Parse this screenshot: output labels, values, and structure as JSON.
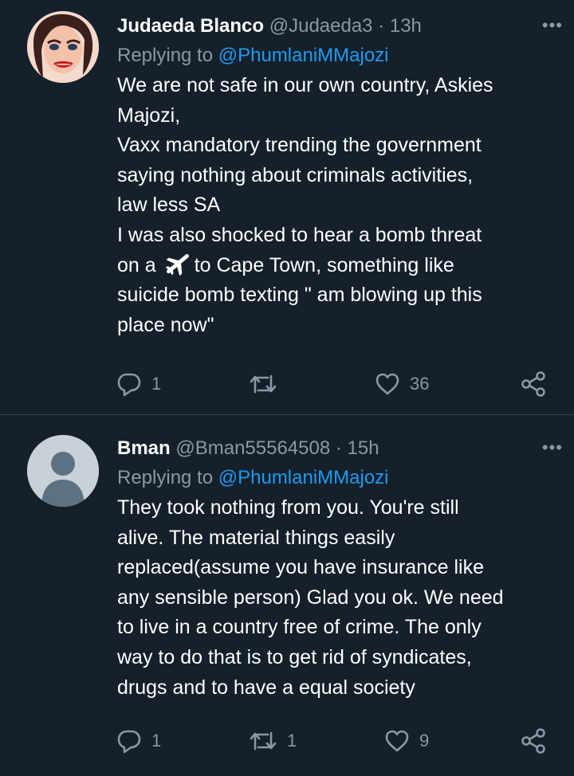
{
  "tweets": [
    {
      "name": "Judaeda Blanco",
      "handle": "@Judaeda3",
      "time": "· 13h",
      "reply_prefix": "Replying to",
      "reply_handle": "@PhumlaniMMajozi",
      "text_before_emoji": "We are not safe in our own country, Askies\nMajozi,\nVaxx mandatory trending the government\nsaying nothing about criminals  activities,\nlaw less SA\nI was also shocked to hear a bomb threat\non a",
      "emoji": "airplane-icon",
      "text_after_emoji": "to Cape Town, something like\nsuicide bomb texting \" am blowing up this\nplace now\"",
      "replies": "1",
      "retweets": "",
      "likes": "36"
    },
    {
      "name": "Bman",
      "handle": "@Bman55564508",
      "time": "· 15h",
      "reply_prefix": "Replying to",
      "reply_handle": "@PhumlaniMMajozi",
      "text": "They took nothing from you. You're still\nalive. The material things easily\nreplaced(assume you have insurance like\nany sensible person)  Glad you ok. We need\nto live in a country free of crime. The only\nway to do that is to get rid of syndicates,\ndrugs and to have a equal society",
      "replies": "1",
      "retweets": "1",
      "likes": "9"
    }
  ],
  "more_icon": "more-dots-icon",
  "colors": {
    "background": "#15202b",
    "secondary": "#8899a6",
    "link": "#1d9bf0",
    "divider": "#38444d"
  }
}
